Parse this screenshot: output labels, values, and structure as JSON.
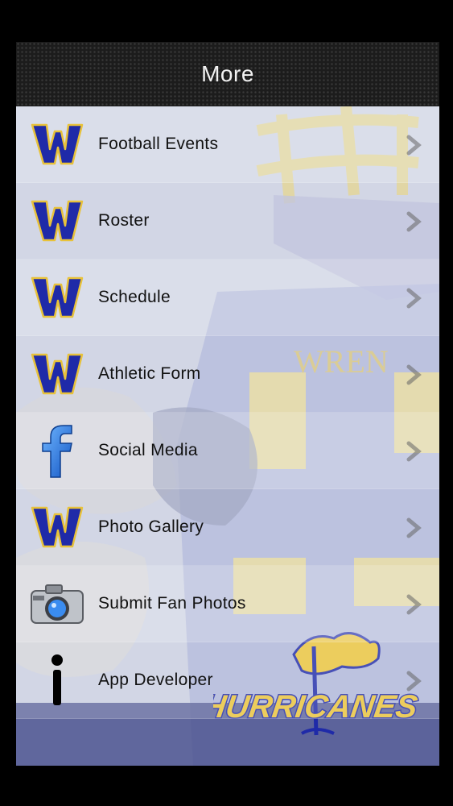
{
  "header": {
    "title": "More"
  },
  "items": [
    {
      "label": "Football Events",
      "icon": "w-logo-icon"
    },
    {
      "label": "Roster",
      "icon": "w-logo-icon"
    },
    {
      "label": "Schedule",
      "icon": "w-logo-icon"
    },
    {
      "label": "Athletic Form",
      "icon": "w-logo-icon"
    },
    {
      "label": "Social Media",
      "icon": "facebook-icon"
    },
    {
      "label": "Photo Gallery",
      "icon": "w-logo-icon"
    },
    {
      "label": "Submit Fan Photos",
      "icon": "camera-icon"
    },
    {
      "label": "App Developer",
      "icon": "info-icon"
    }
  ],
  "background": {
    "jersey_text": "WREN",
    "brand_text": "HURRICANES"
  },
  "colors": {
    "accent_blue": "#1f2aa8",
    "accent_gold": "#e8c23a",
    "header_bg": "#1c1c1c"
  }
}
